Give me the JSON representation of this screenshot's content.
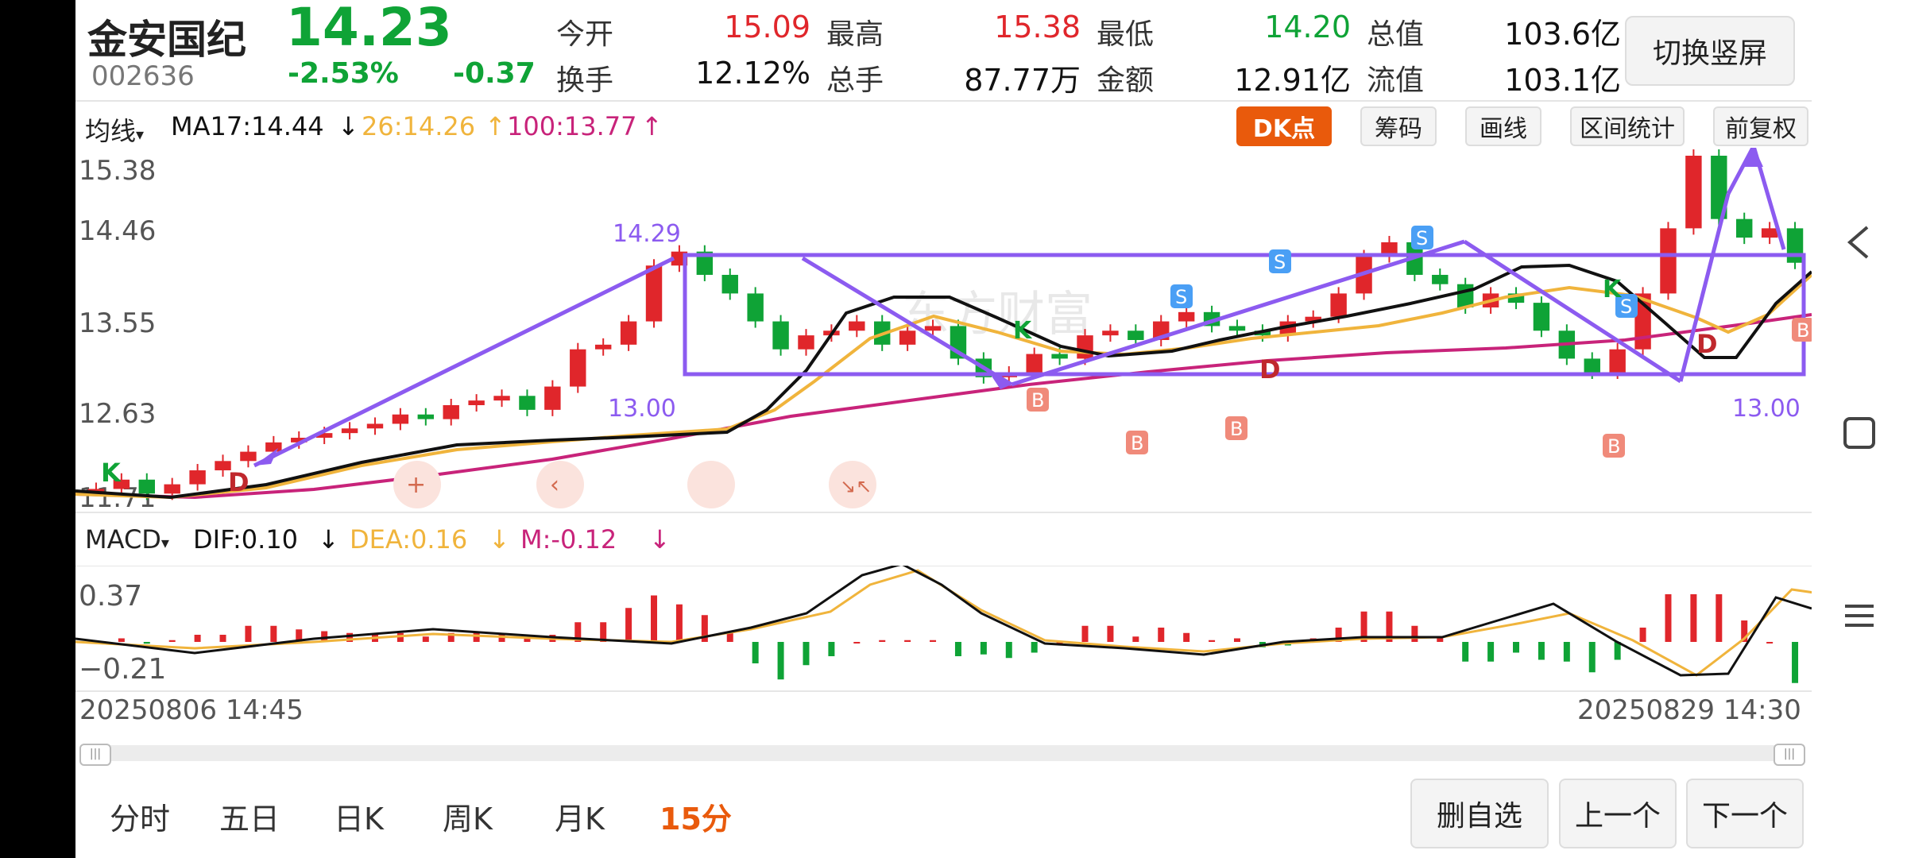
{
  "stock": {
    "name": "金安国纪",
    "code": "002636",
    "price": "14.23",
    "change_pct": "-2.53%",
    "change": "-0.37"
  },
  "quote": {
    "open_label": "今开",
    "open": "15.09",
    "high_label": "最高",
    "high": "15.38",
    "low_label": "最低",
    "low": "14.20",
    "total_value_label": "总值",
    "total_value": "103.6亿",
    "turnover_label": "换手",
    "turnover": "12.12%",
    "volume_label": "总手",
    "volume": "87.77万",
    "amount_label": "金额",
    "amount": "12.91亿",
    "float_value_label": "流值",
    "float_value": "103.1亿"
  },
  "toggle_button": "切换竖屏",
  "indicator_bar": {
    "selector": "均线",
    "ma17": "MA17:14.44",
    "ma26": "26:14.26",
    "ma100": "100:13.77",
    "ma17_arrow": "↓",
    "ma26_arrow": "↑",
    "ma100_arrow": "↑"
  },
  "tools": {
    "dk": "DK点",
    "chips": "筹码",
    "draw": "画线",
    "range_stats": "区间统计",
    "adjust": "前复权"
  },
  "price_axis": [
    "15.38",
    "14.46",
    "13.55",
    "12.63",
    "11.71"
  ],
  "annotations": {
    "upper": "14.29",
    "lower_left": "13.00",
    "lower_right": "13.00"
  },
  "signals": {
    "k": "K",
    "d": "D",
    "b": "B",
    "s": "S"
  },
  "macd_bar": {
    "selector": "MACD",
    "dif": "DIF:0.10",
    "dea": "DEA:0.16",
    "m": "M:-0.12",
    "arrow": "↓"
  },
  "macd_axis": [
    "0.37",
    "−0.21"
  ],
  "dates": {
    "start": "20250806 14:45",
    "end": "20250829 14:30"
  },
  "periods": [
    "分时",
    "五日",
    "日K",
    "周K",
    "月K",
    "15分"
  ],
  "active_period": "15分",
  "bottom_buttons": {
    "remove": "删自选",
    "prev": "上一个",
    "next": "下一个"
  },
  "colors": {
    "up": "#e0262b",
    "down": "#0fa336",
    "ma17": "#111111",
    "ma26": "#f0b43c",
    "ma100": "#c8237a",
    "drawing": "#8c5bf0",
    "accent": "#e95a0c"
  },
  "chart_data": {
    "type": "candlestick",
    "interval": "15分",
    "start": "20250806 14:45",
    "end": "20250829 14:30",
    "ylim": [
      11.71,
      15.38
    ],
    "close_series": [
      11.8,
      11.9,
      11.75,
      11.85,
      12.0,
      12.1,
      12.2,
      12.3,
      12.35,
      12.4,
      12.45,
      12.5,
      12.6,
      12.55,
      12.7,
      12.75,
      12.8,
      12.65,
      12.9,
      13.3,
      13.35,
      13.6,
      14.2,
      14.35,
      14.1,
      13.9,
      13.6,
      13.3,
      13.45,
      13.5,
      13.6,
      13.35,
      13.5,
      13.55,
      13.2,
      13.0,
      13.05,
      13.25,
      13.2,
      13.45,
      13.5,
      13.4,
      13.6,
      13.7,
      13.55,
      13.5,
      13.45,
      13.6,
      13.65,
      13.9,
      14.3,
      14.45,
      14.1,
      14.0,
      13.75,
      13.9,
      13.8,
      13.5,
      13.2,
      13.05,
      13.3,
      13.9,
      14.6,
      15.38,
      14.7,
      14.5,
      14.6,
      14.23
    ],
    "ma17_last": 14.44,
    "ma26_last": 14.26,
    "ma100_last": 13.77,
    "macd": {
      "dif": 0.1,
      "dea": 0.16,
      "m": -0.12,
      "ylim": [
        -0.21,
        0.37
      ]
    }
  }
}
